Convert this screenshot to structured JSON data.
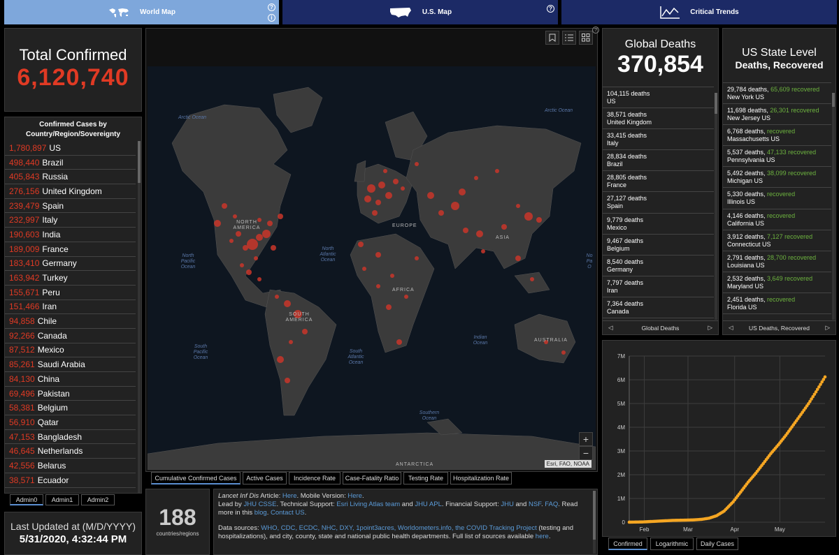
{
  "nav": {
    "world": "World Map",
    "us": "U.S. Map",
    "trends": "Critical Trends",
    "help": "?"
  },
  "total_confirmed": {
    "title": "Total Confirmed",
    "value": "6,120,740"
  },
  "country_list": {
    "header_line1": "Confirmed Cases by",
    "header_line2": "Country/Region/Sovereignty",
    "items": [
      {
        "n": "1,780,897",
        "name": "US"
      },
      {
        "n": "498,440",
        "name": "Brazil"
      },
      {
        "n": "405,843",
        "name": "Russia"
      },
      {
        "n": "276,156",
        "name": "United Kingdom"
      },
      {
        "n": "239,479",
        "name": "Spain"
      },
      {
        "n": "232,997",
        "name": "Italy"
      },
      {
        "n": "190,603",
        "name": "India"
      },
      {
        "n": "189,009",
        "name": "France"
      },
      {
        "n": "183,410",
        "name": "Germany"
      },
      {
        "n": "163,942",
        "name": "Turkey"
      },
      {
        "n": "155,671",
        "name": "Peru"
      },
      {
        "n": "151,466",
        "name": "Iran"
      },
      {
        "n": "94,858",
        "name": "Chile"
      },
      {
        "n": "92,266",
        "name": "Canada"
      },
      {
        "n": "87,512",
        "name": "Mexico"
      },
      {
        "n": "85,261",
        "name": "Saudi Arabia"
      },
      {
        "n": "84,130",
        "name": "China"
      },
      {
        "n": "69,496",
        "name": "Pakistan"
      },
      {
        "n": "58,381",
        "name": "Belgium"
      },
      {
        "n": "56,910",
        "name": "Qatar"
      },
      {
        "n": "47,153",
        "name": "Bangladesh"
      },
      {
        "n": "46,645",
        "name": "Netherlands"
      },
      {
        "n": "42,556",
        "name": "Belarus"
      },
      {
        "n": "38,571",
        "name": "Ecuador"
      }
    ],
    "tabs": [
      "Admin0",
      "Admin1",
      "Admin2"
    ]
  },
  "last_updated": {
    "label": "Last Updated at (M/D/YYYY)",
    "value": "5/31/2020, 4:32:44 PM"
  },
  "countries_count": {
    "value": "188",
    "label": "countries/regions"
  },
  "map": {
    "oceans": {
      "arctic1": "Arctic Ocean",
      "arctic2": "Arctic Ocean",
      "north_pacific": "North Pacific Ocean",
      "north_atlantic": "North Atlantic Ocean",
      "south_pacific": "South Pacific Ocean",
      "south_atlantic": "South Atlantic Ocean",
      "indian": "Indian Ocean",
      "southern": "Southern Ocean",
      "north_pacific_east": "No Pa O"
    },
    "continents": {
      "north_america": "NORTH AMERICA",
      "south_america": "SOUTH AMERICA",
      "europe": "EUROPE",
      "asia": "ASIA",
      "africa": "AFRICA",
      "australia": "AUSTRALIA",
      "antarctica": "ANTARCTICA"
    },
    "attribution": "Esri, FAO, NOAA",
    "zoom_in": "+",
    "zoom_out": "−",
    "tabs": [
      "Cumulative Confirmed Cases",
      "Active Cases",
      "Incidence Rate",
      "Case-Fatality Ratio",
      "Testing Rate",
      "Hospitalization Rate"
    ]
  },
  "info": {
    "line1_a": "Lancet Inf Dis",
    "line1_b": " Article: ",
    "line1_here": "Here",
    "line1_c": ". Mobile Version: ",
    "line1_here2": "Here",
    "line2_a": "Lead by ",
    "line2_jhu": "JHU CSSE",
    "line2_b": ". Technical Support: ",
    "line2_esri": "Esri Living Atlas team",
    "line2_c": " and ",
    "line2_apl": "JHU APL",
    "line2_d": ". Financial Support: ",
    "line2_jhu2": "JHU",
    "line2_e": " and ",
    "line2_nsf": "NSF",
    "line2_f": ". ",
    "line2_faq": "FAQ",
    "line2_g": ". Read more in this ",
    "line2_blog": "blog",
    "line2_h": ". ",
    "line2_contact": "Contact US",
    "line2_i": ".",
    "line3_a": "Data sources: ",
    "line3_sources": "WHO, CDC, ECDC, NHC, DXY, 1point3acres, Worldometers.info, the COVID Tracking Project",
    "line3_b": " (testing and hospitalizations), and city, county, state and national public health departments. Full list of sources available ",
    "line3_here": "here",
    "line3_c": "."
  },
  "global_deaths": {
    "title": "Global Deaths",
    "value": "370,854",
    "items": [
      {
        "n": "104,115 deaths",
        "place": "US"
      },
      {
        "n": "38,571 deaths",
        "place": "United Kingdom"
      },
      {
        "n": "33,415 deaths",
        "place": "Italy"
      },
      {
        "n": "28,834 deaths",
        "place": "Brazil"
      },
      {
        "n": "28,805 deaths",
        "place": "France"
      },
      {
        "n": "27,127 deaths",
        "place": "Spain"
      },
      {
        "n": "9,779 deaths",
        "place": "Mexico"
      },
      {
        "n": "9,467 deaths",
        "place": "Belgium"
      },
      {
        "n": "8,540 deaths",
        "place": "Germany"
      },
      {
        "n": "7,797 deaths",
        "place": "Iran"
      },
      {
        "n": "7,364 deaths",
        "place": "Canada"
      }
    ],
    "footer": "Global Deaths"
  },
  "us_state": {
    "title1": "US State Level",
    "title2": "Deaths, Recovered",
    "items": [
      {
        "d": "29,784 deaths, ",
        "r": "65,609",
        "rl": " recovered",
        "place": "New York US"
      },
      {
        "d": "11,698 deaths, ",
        "r": "26,301",
        "rl": " recovered",
        "place": "New Jersey US"
      },
      {
        "d": "6,768 deaths, ",
        "r": "",
        "rl": " recovered",
        "place": "Massachusetts US"
      },
      {
        "d": "5,537 deaths, ",
        "r": "47,133",
        "rl": " recovered",
        "place": "Pennsylvania US"
      },
      {
        "d": "5,492 deaths, ",
        "r": "38,099",
        "rl": " recovered",
        "place": "Michigan US"
      },
      {
        "d": "5,330 deaths, ",
        "r": "",
        "rl": " recovered",
        "place": "Illinois US"
      },
      {
        "d": "4,146 deaths, ",
        "r": "",
        "rl": " recovered",
        "place": "California US"
      },
      {
        "d": "3,912 deaths, ",
        "r": "7,127",
        "rl": " recovered",
        "place": "Connecticut US"
      },
      {
        "d": "2,791 deaths, ",
        "r": "28,700",
        "rl": " recovered",
        "place": "Louisiana US"
      },
      {
        "d": "2,532 deaths, ",
        "r": "3,649",
        "rl": " recovered",
        "place": "Maryland US"
      },
      {
        "d": "2,451 deaths, ",
        "r": "",
        "rl": " recovered",
        "place": "Florida US"
      }
    ],
    "footer": "US Deaths, Recovered"
  },
  "trend_tabs": [
    "Confirmed",
    "Logarithmic",
    "Daily Cases"
  ],
  "chart_data": {
    "type": "scatter",
    "title": "",
    "xlabel": "",
    "ylabel": "",
    "y_ticks": [
      "0",
      "1M",
      "2M",
      "3M",
      "4M",
      "5M",
      "6M",
      "7M"
    ],
    "x_ticks": [
      "Feb",
      "Mar",
      "Apr",
      "May"
    ],
    "ylim": [
      0,
      7000000
    ],
    "x_tick_dates": [
      "2020-02-01",
      "2020-03-01",
      "2020-04-01",
      "2020-05-01"
    ],
    "xlim": [
      "2020-01-22",
      "2020-05-31"
    ],
    "color": "#f5a623",
    "series": [
      {
        "points": [
          [
            "2020-01-22",
            555
          ],
          [
            "2020-01-31",
            9900
          ],
          [
            "2020-02-10",
            43000
          ],
          [
            "2020-02-20",
            76000
          ],
          [
            "2020-02-29",
            87000
          ],
          [
            "2020-03-05",
            97000
          ],
          [
            "2020-03-10",
            119000
          ],
          [
            "2020-03-15",
            168000
          ],
          [
            "2020-03-20",
            272000
          ],
          [
            "2020-03-25",
            467000
          ],
          [
            "2020-03-31",
            858000
          ],
          [
            "2020-04-05",
            1270000
          ],
          [
            "2020-04-10",
            1690000
          ],
          [
            "2020-04-15",
            2060000
          ],
          [
            "2020-04-20",
            2470000
          ],
          [
            "2020-04-25",
            2890000
          ],
          [
            "2020-04-30",
            3260000
          ],
          [
            "2020-05-05",
            3660000
          ],
          [
            "2020-05-10",
            4100000
          ],
          [
            "2020-05-15",
            4540000
          ],
          [
            "2020-05-20",
            4990000
          ],
          [
            "2020-05-25",
            5490000
          ],
          [
            "2020-05-31",
            6120740
          ]
        ]
      }
    ]
  }
}
